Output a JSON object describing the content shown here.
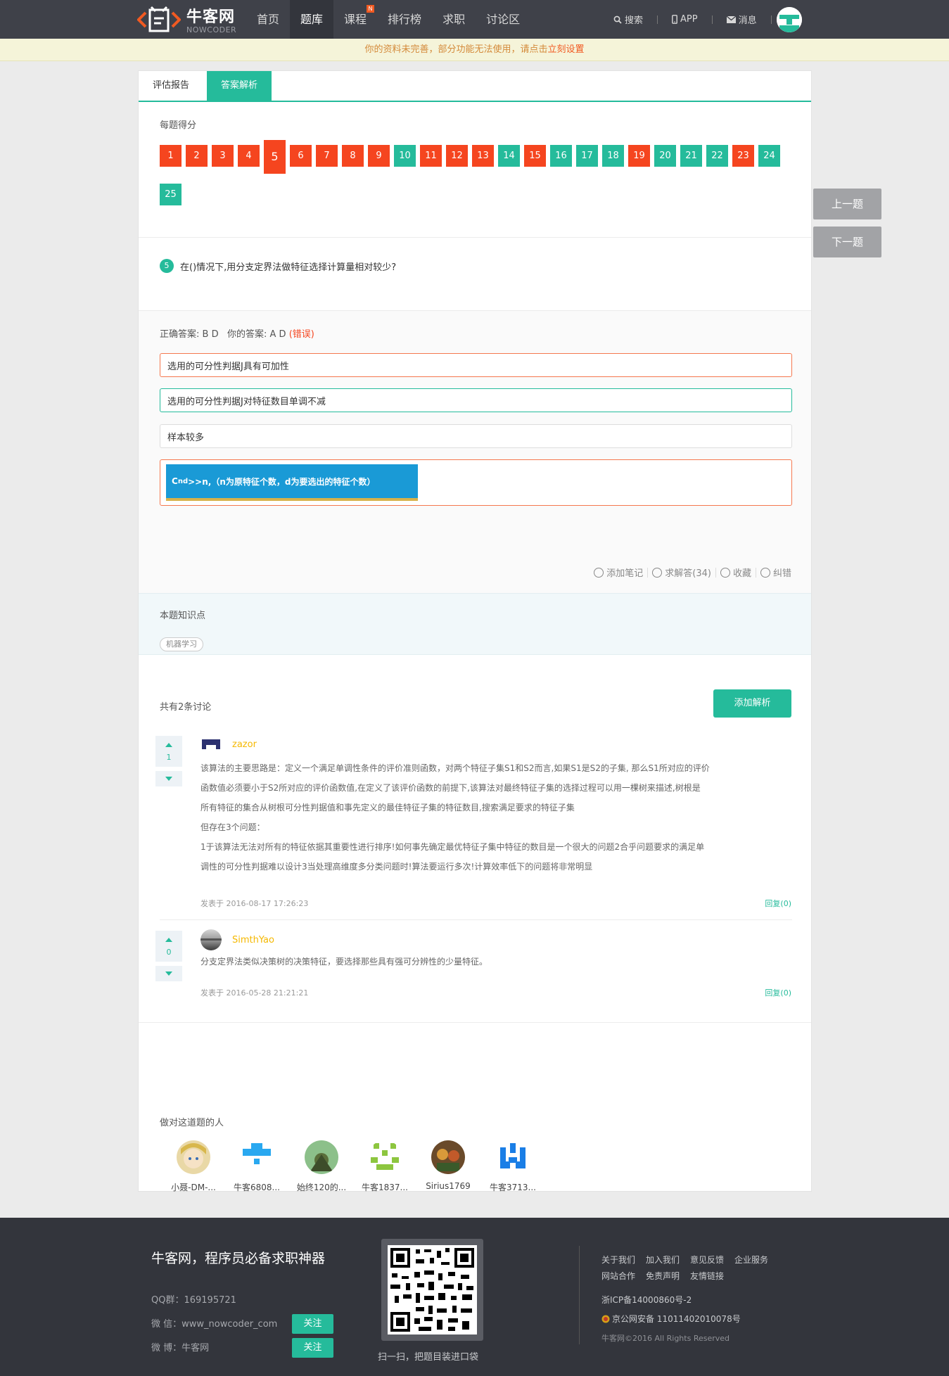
{
  "header": {
    "logo_cn": "牛客网",
    "logo_en": "NOWCODER",
    "nav": [
      {
        "label": "首页",
        "active": false
      },
      {
        "label": "题库",
        "active": true
      },
      {
        "label": "课程",
        "active": false,
        "badge": "N"
      },
      {
        "label": "排行榜",
        "active": false
      },
      {
        "label": "求职",
        "active": false
      },
      {
        "label": "讨论区",
        "active": false
      }
    ],
    "search_label": "搜索",
    "app_label": "APP",
    "message_label": "消息"
  },
  "notice": {
    "text": "你的资料未完善，部分功能无法使用，请点击",
    "link": "立刻设置"
  },
  "tabs": {
    "report": "评估报告",
    "analysis": "答案解析"
  },
  "scores": {
    "label": "每题得分",
    "current": 5,
    "items": [
      {
        "n": "1",
        "status": "wrong"
      },
      {
        "n": "2",
        "status": "wrong"
      },
      {
        "n": "3",
        "status": "wrong"
      },
      {
        "n": "4",
        "status": "wrong"
      },
      {
        "n": "5",
        "status": "wrong"
      },
      {
        "n": "6",
        "status": "wrong"
      },
      {
        "n": "7",
        "status": "wrong"
      },
      {
        "n": "8",
        "status": "wrong"
      },
      {
        "n": "9",
        "status": "wrong"
      },
      {
        "n": "10",
        "status": "right"
      },
      {
        "n": "11",
        "status": "wrong"
      },
      {
        "n": "12",
        "status": "wrong"
      },
      {
        "n": "13",
        "status": "wrong"
      },
      {
        "n": "14",
        "status": "right"
      },
      {
        "n": "15",
        "status": "wrong"
      },
      {
        "n": "16",
        "status": "right"
      },
      {
        "n": "17",
        "status": "right"
      },
      {
        "n": "18",
        "status": "right"
      },
      {
        "n": "19",
        "status": "wrong"
      },
      {
        "n": "20",
        "status": "right"
      },
      {
        "n": "21",
        "status": "right"
      },
      {
        "n": "22",
        "status": "right"
      },
      {
        "n": "23",
        "status": "wrong"
      },
      {
        "n": "24",
        "status": "right"
      },
      {
        "n": "25",
        "status": "right"
      }
    ]
  },
  "question": {
    "number": "5",
    "text": "在()情况下,用分支定界法做特征选择计算量相对较少?"
  },
  "answer": {
    "correct_label": "正确答案: B D",
    "yours_label": "你的答案: A D",
    "verdict": "(错误)",
    "options": [
      {
        "text": "选用的可分性判据J具有可加性",
        "state": "red"
      },
      {
        "text": "选用的可分性判据J对特征数目单调不减",
        "state": "green"
      },
      {
        "text": "样本较多",
        "state": "plain"
      }
    ],
    "option_image": {
      "base": "C",
      "sub": "n",
      "sup": "d",
      "rest": ">>n,（n为原特征个数，d为要选出的特征个数）"
    }
  },
  "actions": {
    "note": "添加笔记",
    "ask": "求解答(34)",
    "fav": "收藏",
    "report": "纠错"
  },
  "knowledge": {
    "title": "本题知识点",
    "tag": "机器学习"
  },
  "discussion": {
    "count": "共有2条讨论",
    "add_button": "添加解析",
    "comments": [
      {
        "votes": "1",
        "user": "zazor",
        "lines": [
          "该算法的主要思路是：定义一个满足单调性条件的评价准则函数，对两个特征子集S1和S2而言,如果S1是S2的子集, 那么S1所对应的评价",
          "函数值必须要小于S2所对应的评价函数值,在定义了该评价函数的前提下,该算法对最终特征子集的选择过程可以用一棵树来描述,树根是",
          "所有特征的集合从树根可分性判据值和事先定义的最佳特征子集的特征数目,搜索满足要求的特征子集",
          "但存在3个问题：",
          "1于该算法无法对所有的特征依据其重要性进行排序!如何事先确定最优特征子集中特征的数目是一个很大的问题2合乎问题要求的满足单",
          "调性的可分性判据难以设计3当处理高维度多分类问题时!算法要运行多次!计算效率低下的问题将非常明显"
        ],
        "date": "发表于 2016-08-17 17:26:23",
        "reply": "回复(0)"
      },
      {
        "votes": "0",
        "user": "SimthYao",
        "lines": [
          "分支定界法类似决策树的决策特征，要选择那些具有强可分辨性的少量特征。"
        ],
        "date": "发表于 2016-05-28 21:21:21",
        "reply": "回复(0)"
      }
    ]
  },
  "solvers": {
    "title": "做对这道题的人",
    "people": [
      {
        "name": "小聂-DM-...",
        "avatar": "anime-avatar"
      },
      {
        "name": "牛客6808...",
        "avatar": "blue-pixel-avatar"
      },
      {
        "name": "始终120的...",
        "avatar": "photo-avatar"
      },
      {
        "name": "牛客1837...",
        "avatar": "green-pixel-avatar"
      },
      {
        "name": "Sirius1769",
        "avatar": "art-avatar"
      },
      {
        "name": "牛客3713...",
        "avatar": "blue-pixel-avatar-2"
      }
    ]
  },
  "side_buttons": {
    "prev": "上一题",
    "next": "下一题"
  },
  "footer": {
    "slogan": "牛客网，程序员必备求职神器",
    "qq": "QQ群：169195721",
    "wechat": "微 信：www_nowcoder_com",
    "weibo": "微 博：牛客网",
    "follow": "关注",
    "qr_caption": "扫一扫，把题目装进口袋",
    "links": [
      "关于我们",
      "加入我们",
      "意见反馈",
      "企业服务",
      "网站合作",
      "免责声明",
      "友情链接"
    ],
    "icp": "浙ICP备14000860号-2",
    "police": "京公网安备 11011402010078号",
    "copyright": "牛客网©2016 All Rights Reserved"
  },
  "colors": {
    "brand_green": "#25bb9b",
    "wrong_red": "#f5451f",
    "header_bg": "#3f4149",
    "footer_bg": "#33353c"
  }
}
